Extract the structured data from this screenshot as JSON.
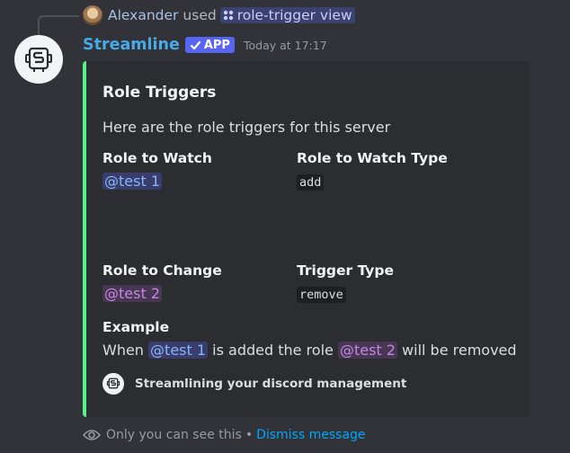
{
  "reply": {
    "username": "Alexander",
    "used_text": "used",
    "command": "role-trigger view"
  },
  "message": {
    "bot_name": "Streamline",
    "badge": "APP",
    "timestamp": "Today at 17:17"
  },
  "embed": {
    "accent_color": "#57f287",
    "title": "Role Triggers",
    "description": "Here are the role triggers for this server",
    "fields": [
      {
        "name": "Role to Watch",
        "value": "@test 1"
      },
      {
        "name": "Role to Watch Type",
        "value": "add"
      },
      {
        "name": "Role to Change",
        "value": "@test 2"
      },
      {
        "name": "Trigger Type",
        "value": "remove"
      }
    ],
    "example": {
      "name": "Example",
      "part1": "When",
      "mention1": "@test 1",
      "part2": "is added the role",
      "mention2": "@test 2",
      "part3": "will be removed"
    },
    "footer": "Streamlining your discord management"
  },
  "ephemeral": {
    "text": "Only you can see this",
    "separator": "•",
    "dismiss": "Dismiss message"
  },
  "icons": [
    "bot-avatar-icon",
    "command-icon",
    "check-icon",
    "eye-icon"
  ]
}
